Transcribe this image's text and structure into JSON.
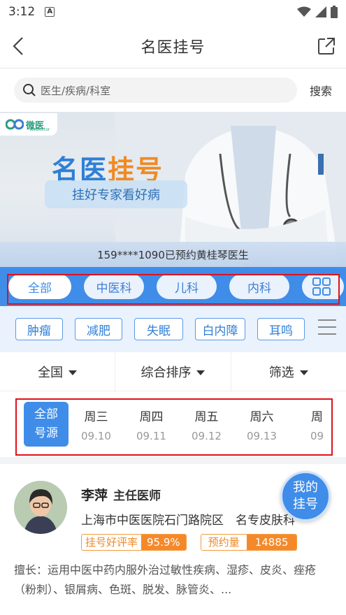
{
  "status": {
    "time": "3:12"
  },
  "nav": {
    "title": "名医挂号"
  },
  "search": {
    "placeholder": "医生/疾病/科室",
    "button": "搜索"
  },
  "banner": {
    "logo_text": "微医",
    "logo_sub": "WeDoctor",
    "heading_blue": "名医",
    "heading_orange": "挂号",
    "tagline": "挂好专家看好病",
    "ticker": "159****1090已预约黄桂琴医生"
  },
  "dept_tabs": [
    {
      "label": "全部"
    },
    {
      "label": "中医科"
    },
    {
      "label": "儿科"
    },
    {
      "label": "内科"
    },
    {
      "label": ""
    }
  ],
  "disease_tags": [
    {
      "label": "肿瘤"
    },
    {
      "label": "减肥"
    },
    {
      "label": "失眠"
    },
    {
      "label": "白内障"
    },
    {
      "label": "耳鸣"
    }
  ],
  "filters": [
    {
      "label": "全国"
    },
    {
      "label": "综合排序"
    },
    {
      "label": "筛选"
    }
  ],
  "dates": {
    "all_line1": "全部",
    "all_line2": "号源",
    "days": [
      {
        "weekday": "周三",
        "date": "09.10"
      },
      {
        "weekday": "周四",
        "date": "09.11"
      },
      {
        "weekday": "周五",
        "date": "09.12"
      },
      {
        "weekday": "周六",
        "date": "09.13"
      },
      {
        "weekday": "周",
        "date": "09"
      }
    ]
  },
  "doctor": {
    "name": "李萍",
    "title": "主任医师",
    "hospital": "上海市中医医院石门路院区　名专皮肤科",
    "rating_label": "挂号好评率",
    "rating_value": "95.9%",
    "booking_label": "预约量",
    "booking_value": "14885",
    "skill": "擅长：运用中医中药内服外治过敏性疾病、湿疹、皮炎、痤疮（粉刺）、银屑病、色斑、脱发、脉管炎、..."
  },
  "float_button": {
    "line1": "我的",
    "line2": "挂号"
  },
  "colors": {
    "primary": "#3f8de9",
    "accent": "#f5892a",
    "highlight": "#e0111a"
  }
}
